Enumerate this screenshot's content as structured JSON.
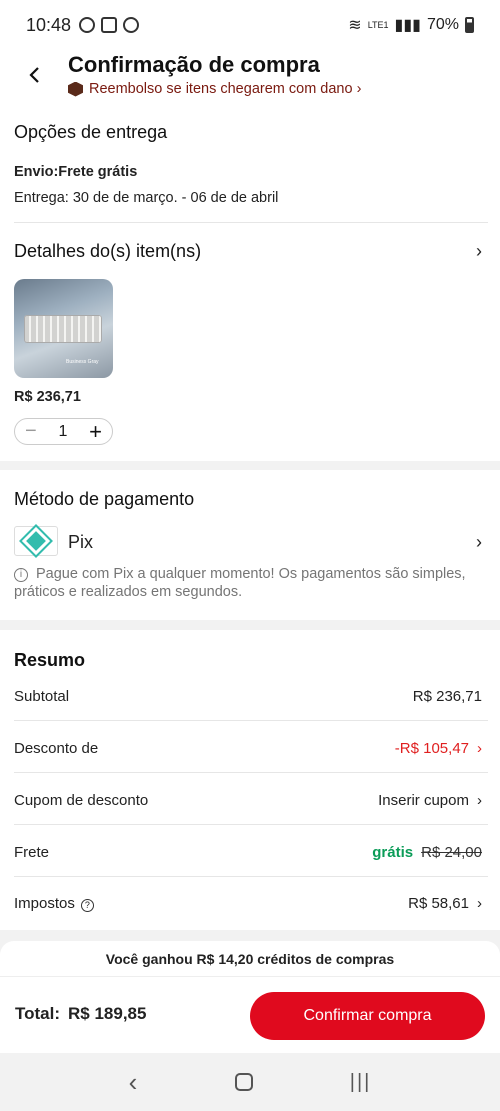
{
  "status_bar": {
    "time": "10:48",
    "battery": "70%",
    "network": "LTE1"
  },
  "header": {
    "title": "Confirmação de compra",
    "refund_text": "Reembolso se itens chegarem com dano ›"
  },
  "delivery": {
    "title": "Opções de entrega",
    "shipping": "Envio:Frete grátis",
    "estimate": "Entrega: 30 de de março. - 06 de de abril"
  },
  "items": {
    "title": "Detalhes do(s) item(ns)",
    "price": "R$ 236,71",
    "quantity": "1",
    "image_caption": "Business Gray"
  },
  "payment": {
    "title": "Método de pagamento",
    "method": "Pix",
    "info": "Pague com Pix a qualquer momento! Os pagamentos são simples, práticos e realizados em segundos."
  },
  "summary": {
    "title": "Resumo",
    "rows": [
      {
        "label": "Subtotal",
        "value": "R$ 236,71"
      },
      {
        "label": "Desconto de",
        "value": "-R$ 105,47"
      },
      {
        "label": "Cupom de desconto",
        "value": "Inserir cupom"
      },
      {
        "label": "Frete",
        "value": "grátis",
        "old_value": "R$ 24,00"
      },
      {
        "label": "Impostos",
        "value": "R$ 58,61"
      }
    ]
  },
  "footer": {
    "credit_text": "Você ganhou R$ 14,20 créditos de compras",
    "total_label": "Total:",
    "total_value": "R$ 189,85",
    "confirm_label": "Confirmar compra"
  },
  "colors": {
    "accent": "#e00a1e",
    "discount": "#e02020",
    "free": "#0b9c58",
    "pix": "#32bcad"
  }
}
